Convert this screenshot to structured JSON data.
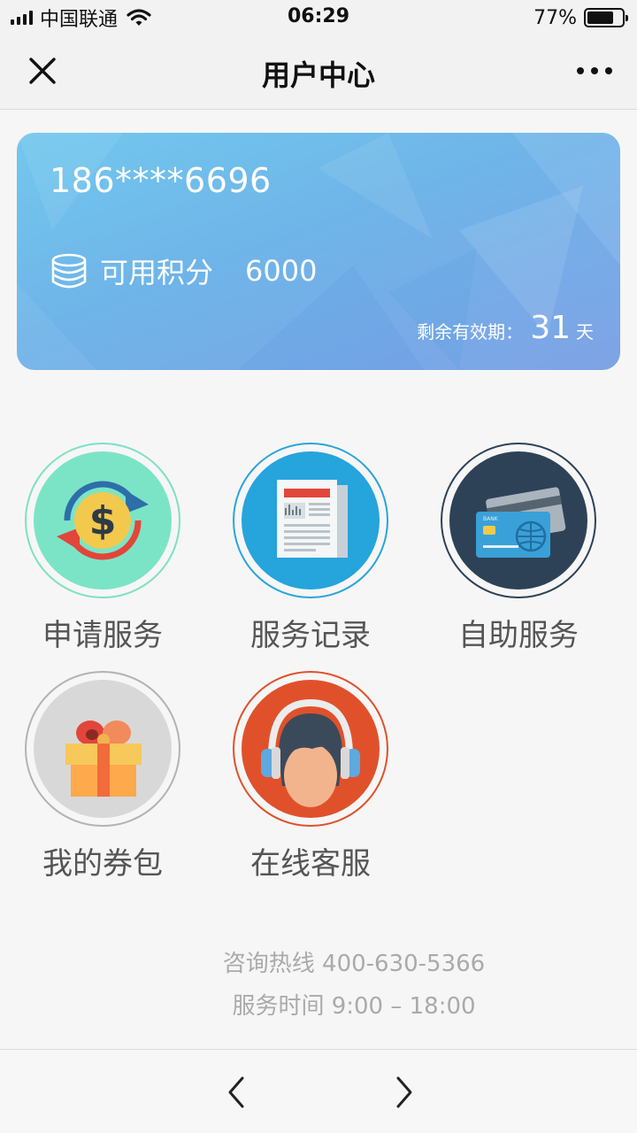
{
  "status_bar": {
    "carrier": "中国联通",
    "time": "06:29",
    "battery_percent": "77%",
    "battery_level": 0.77
  },
  "nav": {
    "title": "用户中心",
    "close_icon": "close-icon",
    "more_icon": "more-icon"
  },
  "card": {
    "phone": "186****6696",
    "points_label": "可用积分",
    "points_value": "6000",
    "points_icon": "coins-icon",
    "validity_label": "剩余有效期：",
    "validity_value": "31",
    "validity_unit": "天",
    "colors": {
      "gradient_start": "#72c8ee",
      "gradient_end": "#7fa3e6"
    }
  },
  "services": [
    {
      "label": "申请服务",
      "icon": "dollar-exchange-icon",
      "ring_color": "#7fe0c4",
      "disc_color": "#7ce4c6"
    },
    {
      "label": "服务记录",
      "icon": "newspaper-icon",
      "ring_color": "#2aa5d9",
      "disc_color": "#26a4dc"
    },
    {
      "label": "自助服务",
      "icon": "bank-card-icon",
      "ring_color": "#2d4257",
      "disc_color": "#2d4257"
    },
    {
      "label": "我的券包",
      "icon": "gift-icon",
      "ring_color": "#b3b3b3",
      "disc_color": "#d8d8d8"
    },
    {
      "label": "在线客服",
      "icon": "customer-service-icon",
      "ring_color": "#e0512b",
      "disc_color": "#e0512b"
    }
  ],
  "info": {
    "hotline": "咨询热线 400-630-5366",
    "hours": "服务时间 9:00 – 18:00"
  },
  "bottom_nav": {
    "back_icon": "chevron-left-icon",
    "forward_icon": "chevron-right-icon"
  }
}
